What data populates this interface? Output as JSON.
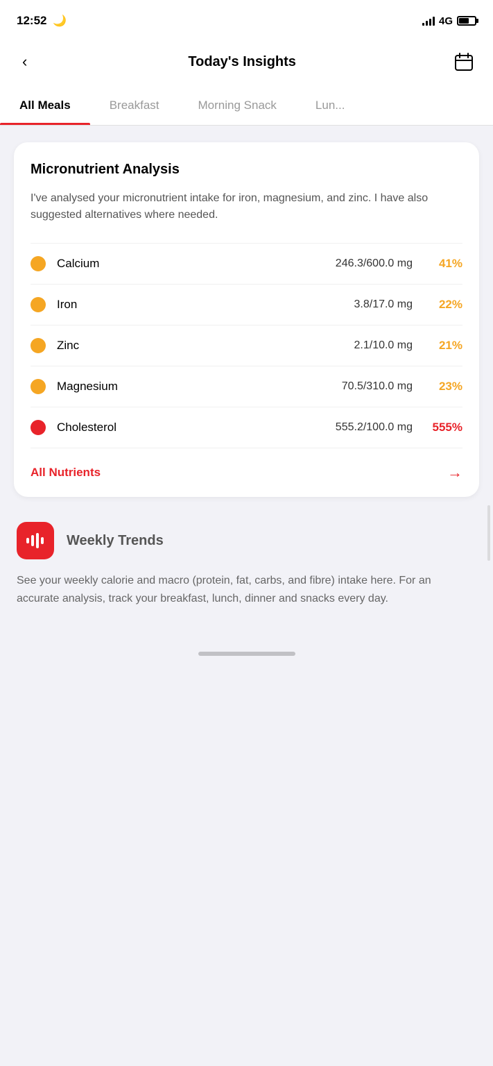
{
  "statusBar": {
    "time": "12:52",
    "signal": "4G",
    "moonIcon": "🌙"
  },
  "header": {
    "backLabel": "‹",
    "title": "Today's Insights",
    "calendarLabel": "calendar"
  },
  "tabs": [
    {
      "id": "all-meals",
      "label": "All Meals",
      "active": true
    },
    {
      "id": "breakfast",
      "label": "Breakfast",
      "active": false
    },
    {
      "id": "morning-snack",
      "label": "Morning Snack",
      "active": false
    },
    {
      "id": "lunch",
      "label": "Lun...",
      "active": false
    }
  ],
  "micronutrient": {
    "title": "Micronutrient Analysis",
    "description": "I've analysed your micronutrient intake for iron, magnesium, and zinc. I have also suggested alternatives where needed.",
    "nutrients": [
      {
        "name": "Calcium",
        "value": "246.3/600.0 mg",
        "percent": "41%",
        "dotColor": "#f5a623",
        "percentClass": "percent-yellow"
      },
      {
        "name": "Iron",
        "value": "3.8/17.0 mg",
        "percent": "22%",
        "dotColor": "#f5a623",
        "percentClass": "percent-yellow"
      },
      {
        "name": "Zinc",
        "value": "2.1/10.0 mg",
        "percent": "21%",
        "dotColor": "#f5a623",
        "percentClass": "percent-yellow"
      },
      {
        "name": "Magnesium",
        "value": "70.5/310.0 mg",
        "percent": "23%",
        "dotColor": "#f5a623",
        "percentClass": "percent-yellow"
      },
      {
        "name": "Cholesterol",
        "value": "555.2/100.0 mg",
        "percent": "555%",
        "dotColor": "#e8232a",
        "percentClass": "percent-red"
      }
    ],
    "footerLabel": "All Nutrients",
    "footerArrow": "→"
  },
  "weeklyTrends": {
    "title": "Weekly Trends",
    "description": "See your weekly calorie and macro (protein, fat, carbs, and fibre) intake here. For an accurate analysis, track your breakfast, lunch, dinner and snacks every day."
  },
  "homeBar": {
    "indicator": "home-indicator"
  }
}
